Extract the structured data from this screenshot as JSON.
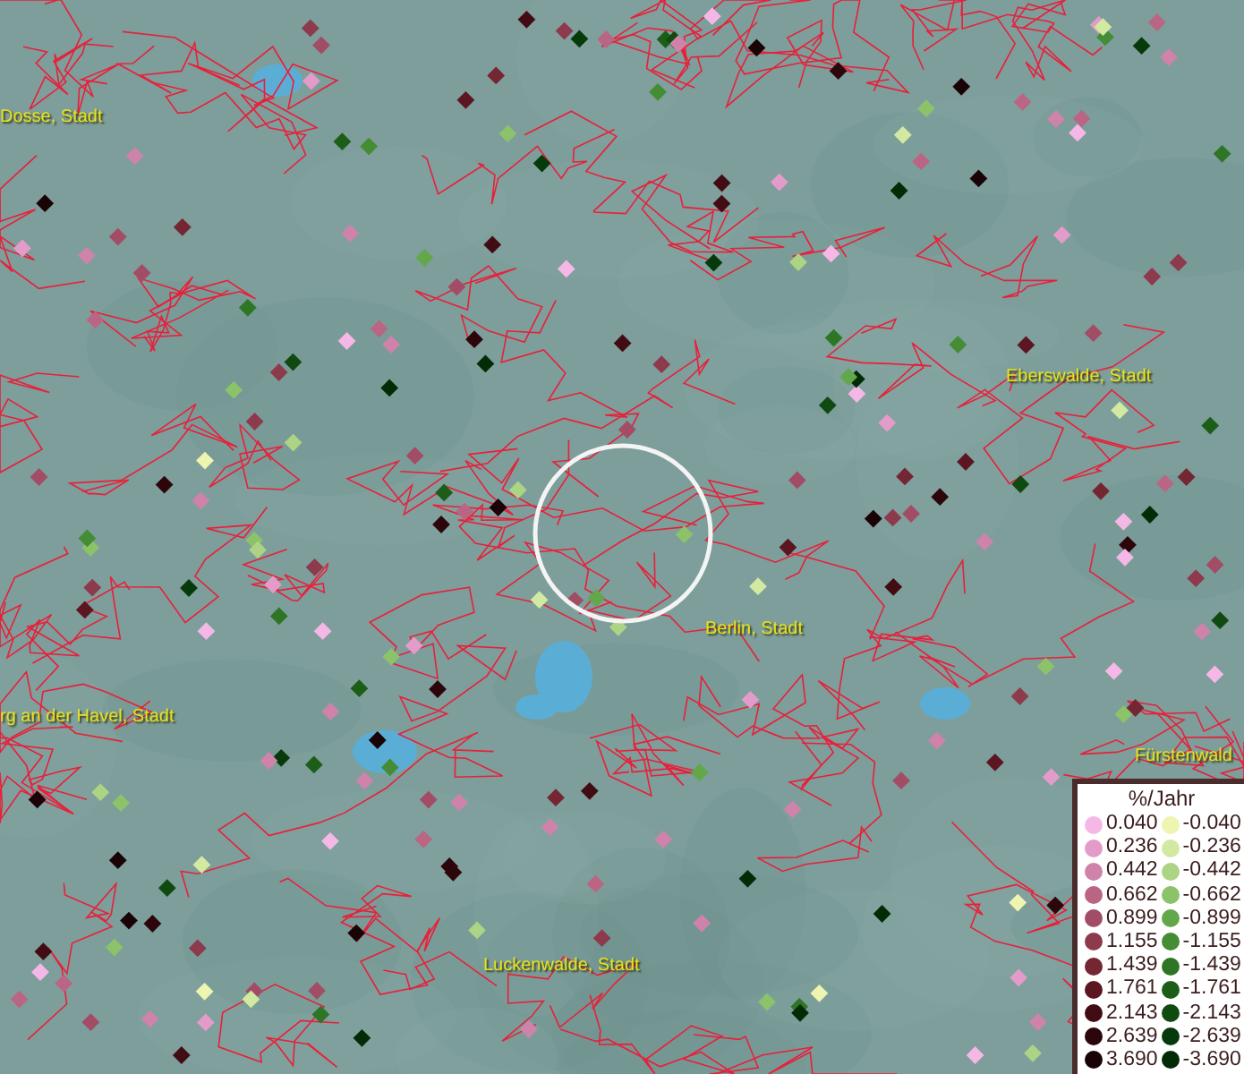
{
  "map": {
    "places": [
      {
        "name": "Dosse, Stadt"
      },
      {
        "name": "Eberswalde, Stadt"
      },
      {
        "name": "Berlin, Stadt"
      },
      {
        "name": "rg an der Havel, Stadt"
      },
      {
        "name": "Fürstenwald"
      },
      {
        "name": "Luckenwalde, Stadt"
      }
    ]
  },
  "legend": {
    "title": "%/Jahr",
    "positive": [
      {
        "value": "0.040",
        "color": "#f5b8e6"
      },
      {
        "value": "0.236",
        "color": "#e39cc9"
      },
      {
        "value": "0.442",
        "color": "#d083aa"
      },
      {
        "value": "0.662",
        "color": "#bb6585"
      },
      {
        "value": "0.899",
        "color": "#a24c66"
      },
      {
        "value": "1.155",
        "color": "#8c3a4c"
      },
      {
        "value": "1.439",
        "color": "#742633"
      },
      {
        "value": "1.761",
        "color": "#5c1622"
      },
      {
        "value": "2.143",
        "color": "#420c14"
      },
      {
        "value": "2.639",
        "color": "#2c060b"
      },
      {
        "value": "3.690",
        "color": "#1a0306"
      }
    ],
    "negative": [
      {
        "value": "-0.040",
        "color": "#eef5b0"
      },
      {
        "value": "-0.236",
        "color": "#d2e9a2"
      },
      {
        "value": "-0.442",
        "color": "#acd484"
      },
      {
        "value": "-0.662",
        "color": "#8cc26a"
      },
      {
        "value": "-0.899",
        "color": "#62a84a"
      },
      {
        "value": "-1.155",
        "color": "#448d34"
      },
      {
        "value": "-1.439",
        "color": "#2e7626"
      },
      {
        "value": "-1.761",
        "color": "#1c5e18"
      },
      {
        "value": "-2.143",
        "color": "#104a10"
      },
      {
        "value": "-2.639",
        "color": "#073a0a"
      },
      {
        "value": "-3.690",
        "color": "#032b06"
      }
    ]
  }
}
